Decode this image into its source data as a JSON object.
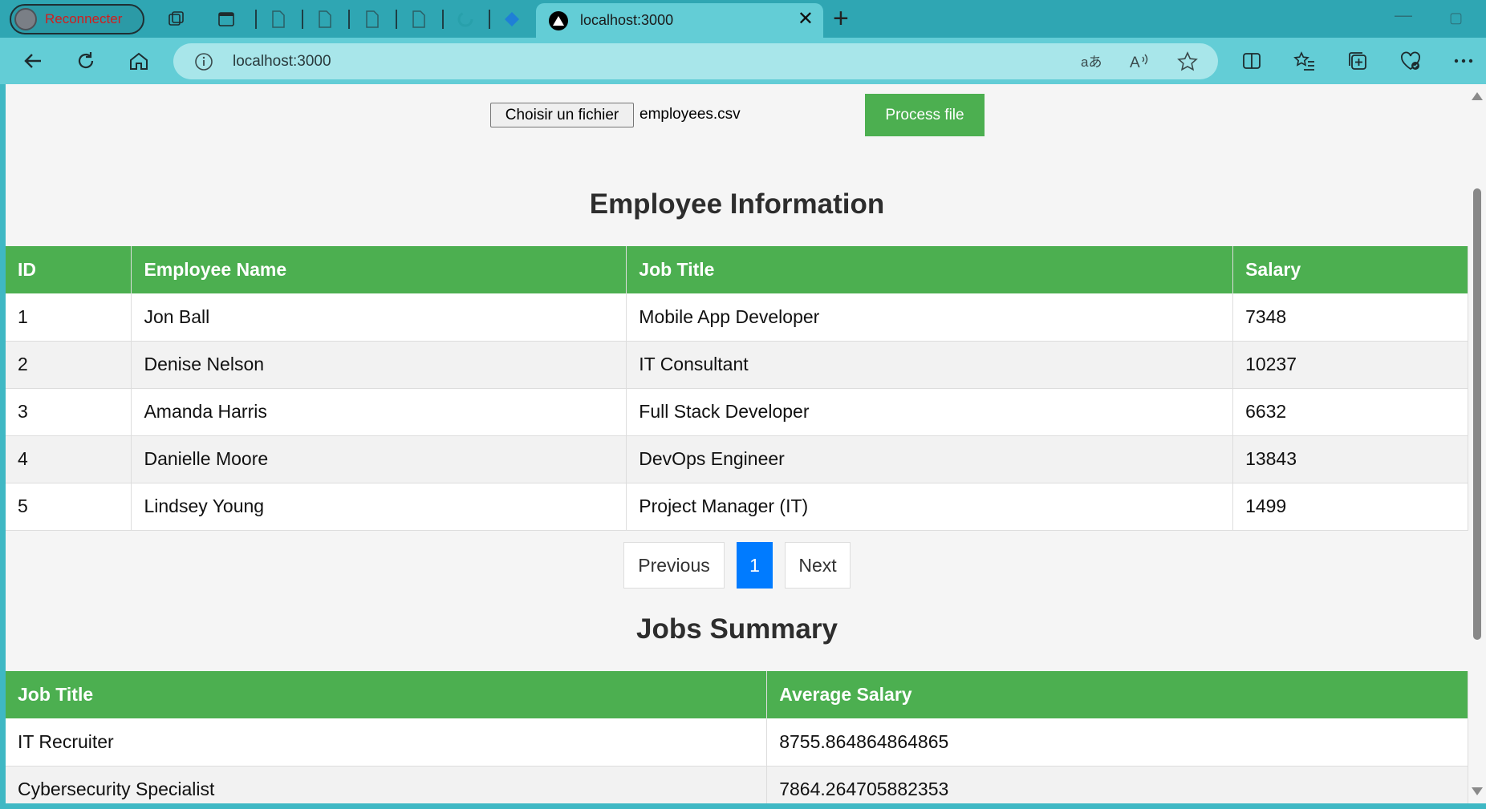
{
  "browser": {
    "reconnect_label": "Reconnecter",
    "active_tab_title": "localhost:3000",
    "url": "localhost:3000",
    "icons": [
      "back-icon",
      "refresh-icon",
      "home-icon",
      "info-icon",
      "translate-icon",
      "read-aloud-icon",
      "favorite-star-icon",
      "split-screen-icon",
      "favorites-icon",
      "collections-icon",
      "health-icon",
      "more-icon"
    ]
  },
  "upload": {
    "choose_label": "Choisir un fichier",
    "file_name": "employees.csv",
    "process_label": "Process file"
  },
  "employees": {
    "heading": "Employee Information",
    "columns": [
      "ID",
      "Employee Name",
      "Job Title",
      "Salary"
    ],
    "rows": [
      [
        "1",
        "Jon Ball",
        "Mobile App Developer",
        "7348"
      ],
      [
        "2",
        "Denise Nelson",
        "IT Consultant",
        "10237"
      ],
      [
        "3",
        "Amanda Harris",
        "Full Stack Developer",
        "6632"
      ],
      [
        "4",
        "Danielle Moore",
        "DevOps Engineer",
        "13843"
      ],
      [
        "5",
        "Lindsey Young",
        "Project Manager (IT)",
        "1499"
      ]
    ]
  },
  "pagination": {
    "previous_label": "Previous",
    "current_page": "1",
    "next_label": "Next"
  },
  "jobs": {
    "heading": "Jobs Summary",
    "columns": [
      "Job Title",
      "Average Salary"
    ],
    "rows": [
      [
        "IT Recruiter",
        "8755.864864864865"
      ],
      [
        "Cybersecurity Specialist",
        "7864.264705882353"
      ]
    ]
  },
  "colors": {
    "accent_green": "#4caf50",
    "active_page_blue": "#007bff",
    "browser_teal": "#63cdd6"
  }
}
